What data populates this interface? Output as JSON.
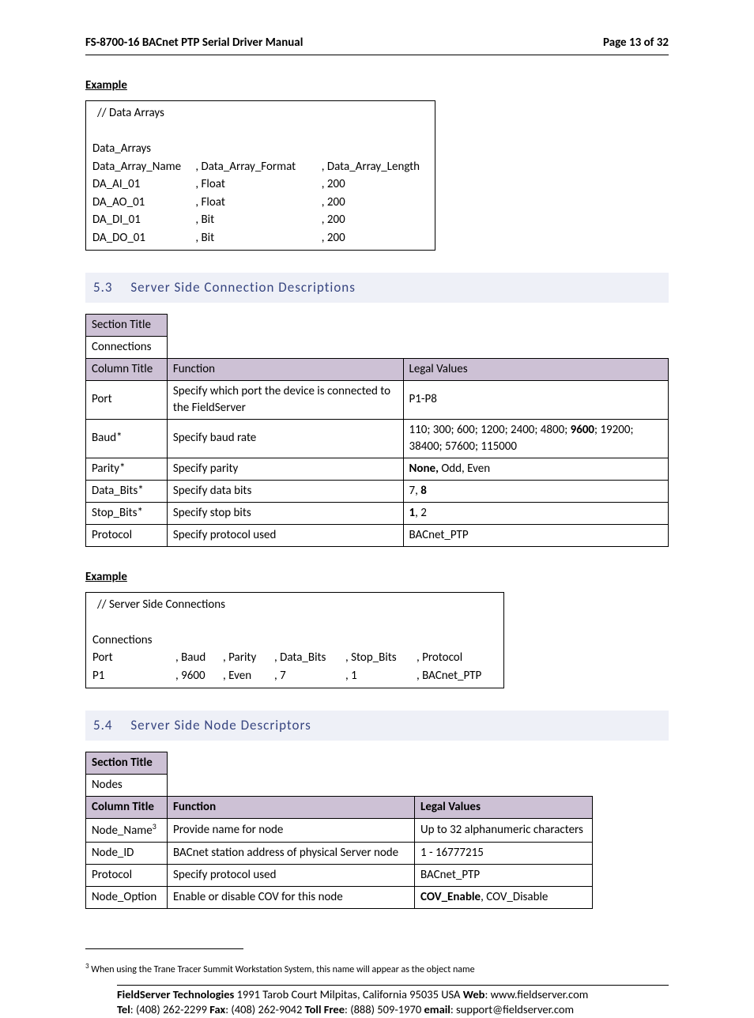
{
  "header": {
    "title": "FS-8700-16 BACnet PTP Serial Driver Manual",
    "page": "Page 13 of 32"
  },
  "example1": {
    "heading": "Example",
    "title": "//     Data Arrays",
    "sectionLabel": "Data_Arrays",
    "cols": {
      "c1": "Data_Array_Name",
      "c2": ", Data_Array_Format",
      "c3": ", Data_Array_Length"
    },
    "rows": [
      {
        "c1": "DA_AI_01",
        "c2": ", Float",
        "c3": ", 200"
      },
      {
        "c1": "DA_AO_01",
        "c2": ", Float",
        "c3": ", 200"
      },
      {
        "c1": "DA_DI_01",
        "c2": ", Bit",
        "c3": ", 200"
      },
      {
        "c1": "DA_DO_01",
        "c2": ", Bit",
        "c3": ", 200"
      }
    ]
  },
  "section53": {
    "number": "5.3",
    "title": "Server Side Connection Descriptions",
    "sectionTitleLabel": "Section Title",
    "sectionTitleValue": "Connections",
    "columnTitleLabel": "Column Title",
    "functionLabel": "Function",
    "legalLabel": "Legal Values",
    "rows": [
      {
        "name": "Port",
        "func": "Specify which port the device is connected to the FieldServer",
        "legal": "P1-P8"
      },
      {
        "name": "Baud*",
        "func": "Specify baud rate",
        "legal_pre": "110; 300; 600; 1200; 2400; 4800; ",
        "legal_bold": "9600",
        "legal_post": "; 19200; 38400; 57600; 115000"
      },
      {
        "name": "Parity*",
        "func": "Specify parity",
        "legal_bold": "None,",
        "legal_post": " Odd, Even"
      },
      {
        "name": "Data_Bits*",
        "func": "Specify data bits",
        "legal_pre": "7, ",
        "legal_bold": "8"
      },
      {
        "name": "Stop_Bits*",
        "func": "Specify stop bits",
        "legal_bold": "1",
        "legal_post": ", 2"
      },
      {
        "name": "Protocol",
        "func": "Specify protocol used",
        "legal": "BACnet_PTP"
      }
    ]
  },
  "example2": {
    "heading": "Example",
    "title": "//    Server Side Connections",
    "sectionLabel": "Connections",
    "cols": {
      "c1": "Port",
      "c2": ", Baud",
      "c3": ", Parity",
      "c4": ", Data_Bits",
      "c5": ", Stop_Bits",
      "c6": ", Protocol"
    },
    "row": {
      "c1": "P1",
      "c2": ", 9600",
      "c3": ", Even",
      "c4": ", 7",
      "c5": ", 1",
      "c6": ", BACnet_PTP"
    }
  },
  "section54": {
    "number": "5.4",
    "title": "Server Side Node Descriptors",
    "sectionTitleLabel": "Section Title",
    "sectionTitleValue": "Nodes",
    "columnTitleLabel": "Column Title",
    "functionLabel": "Function",
    "legalLabel": "Legal Values",
    "rows": [
      {
        "name": "Node_Name",
        "sup": "3",
        "func": "Provide name for node",
        "legal": "Up to 32 alphanumeric characters"
      },
      {
        "name": "Node_ID",
        "func": "BACnet station address of physical Server node",
        "legal": "1 - 16777215"
      },
      {
        "name": "Protocol",
        "func": "Specify protocol used",
        "legal": "BACnet_PTP"
      },
      {
        "name": "Node_Option",
        "func": "Enable or disable COV for this node",
        "legal_bold": "COV_Enable",
        "legal_post": ", COV_Disable"
      }
    ]
  },
  "footnote": {
    "num": "3",
    "text": " When using the Trane Tracer Summit Workstation System, this name will appear as the object name"
  },
  "footer": {
    "line1_bold1": "FieldServer Technologies",
    "line1_addr": " 1991 Tarob Court Milpitas, California 95035 USA   ",
    "line1_web_lbl": "Web",
    "line1_web_val": ": www.fieldserver.com",
    "line2_tel_lbl": "Tel",
    "line2_tel_val": ": (408) 262-2299   ",
    "line2_fax_lbl": "Fax",
    "line2_fax_val": ": (408) 262-9042   ",
    "line2_toll_lbl": "Toll Free",
    "line2_toll_val": ": (888) 509-1970   ",
    "line2_email_lbl": "email",
    "line2_email_val": ": support@fieldserver.com"
  }
}
